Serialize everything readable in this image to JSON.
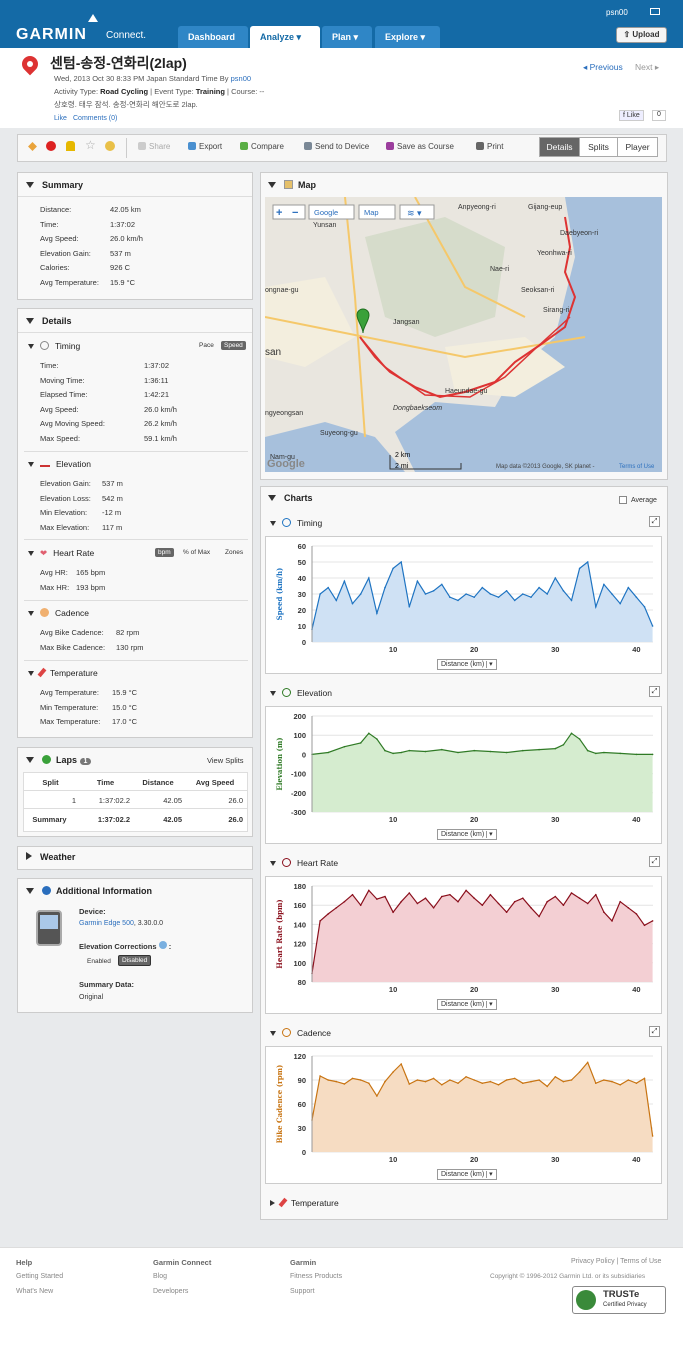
{
  "nav": {
    "brand": "GARMIN",
    "brand_sub": "Connect.",
    "tabs": [
      "Dashboard",
      "Analyze",
      "Plan",
      "Explore"
    ],
    "user": "psn00",
    "upload": "Upload"
  },
  "activity": {
    "title": "센텀-송정-연화리(2lap)",
    "datetime": "Wed, 2013 Oct 30 8:33 PM Japan Standard Time By",
    "author": "psn00",
    "type_label": "Activity Type:",
    "type": "Road Cycling",
    "event_label": "| Event Type:",
    "event": "Training",
    "course": "| Course: --",
    "description": "상호령. 태우 잠석. 송정-연화리 해안도로 2lap.",
    "like": "Like",
    "comments": "Comments (0)",
    "prev": "Previous",
    "next": "Next",
    "fb_like": "Like",
    "fb_count": "0"
  },
  "toolbar": {
    "share": "Share",
    "export": "Export",
    "compare": "Compare",
    "send": "Send to Device",
    "save_course": "Save as Course",
    "print": "Print",
    "views": [
      "Details",
      "Splits",
      "Player"
    ]
  },
  "summary": {
    "title": "Summary",
    "rows": [
      [
        "Distance:",
        "42.05 km"
      ],
      [
        "Time:",
        "1:37:02"
      ],
      [
        "Avg Speed:",
        "26.0 km/h"
      ],
      [
        "Elevation Gain:",
        "537 m"
      ],
      [
        "Calories:",
        "926 C"
      ],
      [
        "Avg Temperature:",
        "15.9 °C"
      ]
    ]
  },
  "details": {
    "title": "Details",
    "timing": {
      "title": "Timing",
      "pace": "Pace",
      "speed": "Speed",
      "rows": [
        [
          "Time:",
          "1:37:02"
        ],
        [
          "Moving Time:",
          "1:36:11"
        ],
        [
          "Elapsed Time:",
          "1:42:21"
        ],
        [
          "Avg Speed:",
          "26.0 km/h"
        ],
        [
          "Avg Moving Speed:",
          "26.2 km/h"
        ],
        [
          "Max Speed:",
          "59.1 km/h"
        ]
      ]
    },
    "elevation": {
      "title": "Elevation",
      "rows": [
        [
          "Elevation Gain:",
          "537 m"
        ],
        [
          "Elevation Loss:",
          "542 m"
        ],
        [
          "Min Elevation:",
          "-12 m"
        ],
        [
          "Max Elevation:",
          "117 m"
        ]
      ]
    },
    "heart": {
      "title": "Heart Rate",
      "bpm": "bpm",
      "pct": "% of Max",
      "zones": "Zones",
      "rows": [
        [
          "Avg HR:",
          "165 bpm"
        ],
        [
          "Max HR:",
          "193 bpm"
        ]
      ]
    },
    "cadence": {
      "title": "Cadence",
      "rows": [
        [
          "Avg Bike Cadence:",
          "82 rpm"
        ],
        [
          "Max Bike Cadence:",
          "130 rpm"
        ]
      ]
    },
    "temperature": {
      "title": "Temperature",
      "rows": [
        [
          "Avg Temperature:",
          "15.9 °C"
        ],
        [
          "Min Temperature:",
          "15.0 °C"
        ],
        [
          "Max Temperature:",
          "17.0 °C"
        ]
      ]
    }
  },
  "laps": {
    "title": "Laps",
    "count": "1",
    "view": "View Splits",
    "headers": [
      "Split",
      "Time",
      "Distance",
      "Avg Speed"
    ],
    "rows": [
      [
        "1",
        "1:37:02.2",
        "42.05",
        "26.0"
      ]
    ],
    "summary": [
      "Summary",
      "1:37:02.2",
      "42.05",
      "26.0"
    ]
  },
  "weather": {
    "title": "Weather"
  },
  "info": {
    "title": "Additional Information",
    "device_label": "Device:",
    "device": "Garmin Edge 500",
    "device_ver": ", 3.30.0.0",
    "elev_label": "Elevation Corrections",
    "enabled": "Enabled",
    "disabled": "Disabled",
    "summary_label": "Summary Data:",
    "summary_val": "Original"
  },
  "map": {
    "title": "Map",
    "google": "Google",
    "maptype": "Map",
    "places": [
      "Anpyeong-ri",
      "Gijang-eup",
      "Yunsan",
      "Daebyeon-ri",
      "Yeonhwa-ri",
      "Nae-ri",
      "Seoksan-ri",
      "ongnae-gu",
      "Jangsan",
      "Sirang-ri",
      "san",
      "Haeundae-gu",
      "Dongbaekseom",
      "ngyeongsan",
      "Suyeong-gu",
      "Nam-gu"
    ],
    "scale_km": "2 km",
    "scale_mi": "2 mi",
    "credit": "Map data ©2013 Google, SK planet -",
    "terms": "Terms of Use"
  },
  "charts": {
    "title": "Charts",
    "average": "Average",
    "xaxis": "Distance (km)",
    "panels": [
      {
        "title": "Timing",
        "ylabel": "Speed (km/h)",
        "color": "#1f74c2",
        "fill": "#cfe1f4",
        "yticks": [
          "60",
          "50",
          "40",
          "30",
          "20",
          "10",
          "0"
        ],
        "xticks": [
          "10",
          "20",
          "30",
          "40"
        ]
      },
      {
        "title": "Elevation",
        "ylabel": "Elevation (m)",
        "color": "#2f7a25",
        "fill": "#d5eccf",
        "yticks": [
          "200",
          "100",
          "0",
          "-100",
          "-200",
          "-300"
        ],
        "xticks": [
          "10",
          "20",
          "30",
          "40"
        ]
      },
      {
        "title": "Heart Rate",
        "ylabel": "Heart Rate (bpm)",
        "color": "#8a0f1c",
        "fill": "#f3cfd3",
        "yticks": [
          "180",
          "160",
          "140",
          "120",
          "100",
          "80"
        ],
        "xticks": [
          "10",
          "20",
          "30",
          "40"
        ]
      },
      {
        "title": "Cadence",
        "ylabel": "Bike Cadence (rpm)",
        "color": "#c87412",
        "fill": "#f6dcc2",
        "yticks": [
          "120",
          "90",
          "60",
          "30",
          "0"
        ],
        "xticks": [
          "10",
          "20",
          "30",
          "40"
        ]
      }
    ],
    "temperature": "Temperature"
  },
  "chart_data": [
    {
      "type": "line",
      "title": "Timing",
      "ylabel": "Speed (km/h)",
      "xlabel": "Distance (km)",
      "xlim": [
        0,
        42.05
      ],
      "ylim": [
        0,
        60
      ],
      "x": [
        0,
        1,
        2,
        3,
        4,
        5,
        6,
        7,
        8,
        9,
        10,
        11,
        12,
        13,
        14,
        15,
        16,
        17,
        18,
        19,
        20,
        21,
        22,
        23,
        24,
        25,
        26,
        27,
        28,
        29,
        30,
        31,
        32,
        33,
        34,
        35,
        36,
        37,
        38,
        39,
        40,
        41,
        42
      ],
      "y": [
        8,
        30,
        34,
        26,
        38,
        24,
        30,
        40,
        18,
        34,
        46,
        50,
        22,
        38,
        30,
        32,
        36,
        28,
        26,
        30,
        28,
        34,
        30,
        28,
        32,
        26,
        30,
        28,
        34,
        30,
        40,
        32,
        26,
        46,
        50,
        22,
        36,
        30,
        24,
        34,
        28,
        22,
        10
      ]
    },
    {
      "type": "area",
      "title": "Elevation",
      "ylabel": "Elevation (m)",
      "xlabel": "Distance (km)",
      "xlim": [
        0,
        42.05
      ],
      "ylim": [
        -300,
        200
      ],
      "x": [
        0,
        2,
        4,
        6,
        7,
        8,
        9,
        10,
        11,
        12,
        14,
        16,
        18,
        20,
        22,
        24,
        26,
        28,
        30,
        31,
        32,
        33,
        34,
        35,
        36,
        38,
        40,
        42
      ],
      "y": [
        0,
        10,
        40,
        60,
        110,
        80,
        20,
        5,
        10,
        20,
        15,
        25,
        10,
        20,
        15,
        10,
        20,
        25,
        30,
        50,
        110,
        80,
        20,
        5,
        10,
        5,
        0,
        0
      ]
    },
    {
      "type": "line",
      "title": "Heart Rate",
      "ylabel": "Heart Rate (bpm)",
      "xlabel": "Distance (km)",
      "xlim": [
        0,
        42.05
      ],
      "ylim": [
        80,
        190
      ],
      "x": [
        0,
        1,
        2,
        3,
        4,
        5,
        6,
        7,
        8,
        9,
        10,
        11,
        12,
        13,
        14,
        15,
        16,
        17,
        18,
        19,
        20,
        21,
        22,
        23,
        24,
        25,
        26,
        27,
        28,
        29,
        30,
        31,
        32,
        33,
        34,
        35,
        36,
        37,
        38,
        39,
        40,
        41,
        42
      ],
      "y": [
        90,
        150,
        158,
        165,
        172,
        180,
        168,
        185,
        175,
        178,
        160,
        172,
        182,
        170,
        176,
        165,
        178,
        180,
        172,
        185,
        176,
        168,
        180,
        170,
        160,
        172,
        176,
        165,
        155,
        172,
        178,
        168,
        182,
        176,
        170,
        180,
        160,
        150,
        172,
        165,
        158,
        145,
        150
      ]
    },
    {
      "type": "bar",
      "title": "Cadence",
      "ylabel": "Bike Cadence (rpm)",
      "xlabel": "Distance (km)",
      "xlim": [
        0,
        42.05
      ],
      "ylim": [
        0,
        120
      ],
      "x": [
        0,
        1,
        2,
        3,
        4,
        5,
        6,
        7,
        8,
        9,
        10,
        11,
        12,
        13,
        14,
        15,
        16,
        17,
        18,
        19,
        20,
        21,
        22,
        23,
        24,
        25,
        26,
        27,
        28,
        29,
        30,
        31,
        32,
        33,
        34,
        35,
        36,
        37,
        38,
        39,
        40,
        41,
        42
      ],
      "y": [
        40,
        95,
        90,
        88,
        85,
        92,
        90,
        86,
        70,
        88,
        100,
        110,
        85,
        90,
        88,
        92,
        84,
        90,
        86,
        94,
        90,
        86,
        88,
        84,
        90,
        92,
        86,
        88,
        90,
        82,
        94,
        88,
        90,
        100,
        112,
        86,
        90,
        88,
        84,
        90,
        86,
        92,
        20
      ]
    }
  ],
  "footer": {
    "help": "Help",
    "help_links": [
      "Getting Started",
      "What's New"
    ],
    "gc": "Garmin Connect",
    "gc_links": [
      "Blog",
      "Developers"
    ],
    "garmin": "Garmin",
    "garmin_links": [
      "Fitness Products",
      "Support"
    ],
    "privacy": "Privacy Policy",
    "terms": "| Terms of Use",
    "copyright": "Copyright © 1996-2012 Garmin Ltd. or its subsidiaries",
    "truste": "TRUSTe",
    "truste_sub": "Certified Privacy"
  }
}
